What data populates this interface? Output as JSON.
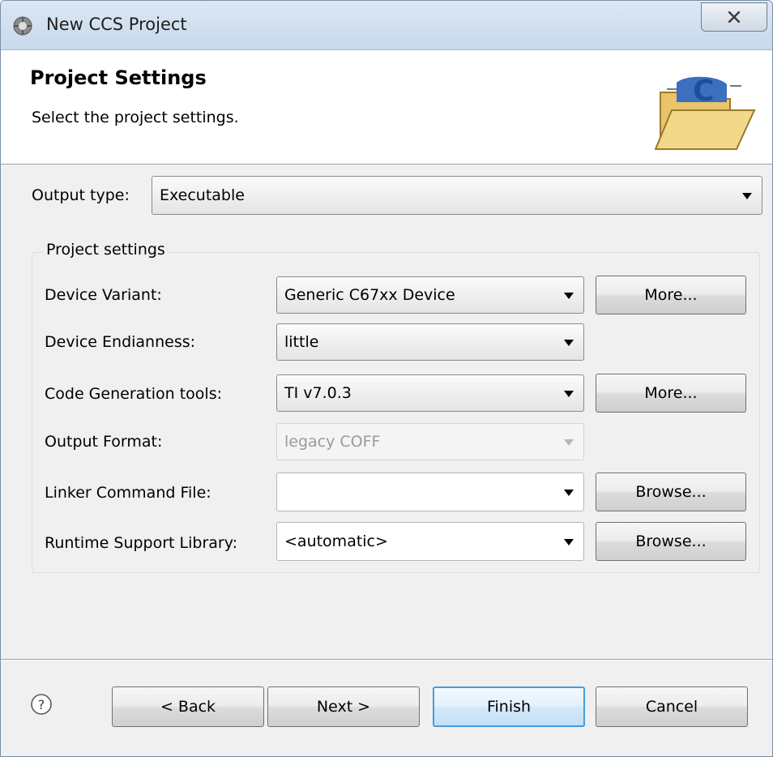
{
  "window": {
    "title": "New CCS Project"
  },
  "header": {
    "title": "Project Settings",
    "description": "Select the project settings."
  },
  "output_type": {
    "label": "Output type:",
    "value": "Executable"
  },
  "project_settings": {
    "legend": "Project settings",
    "device_variant": {
      "label": "Device Variant:",
      "value": "Generic C67xx Device",
      "button": "More..."
    },
    "device_endianness": {
      "label": "Device Endianness:",
      "value": "little"
    },
    "code_generation_tools": {
      "label": "Code Generation tools:",
      "value": "TI v7.0.3",
      "button": "More..."
    },
    "output_format": {
      "label": "Output Format:",
      "value": "legacy COFF"
    },
    "linker_command_file": {
      "label": "Linker Command File:",
      "value": "",
      "button": "Browse..."
    },
    "runtime_support_library": {
      "label": "Runtime Support Library:",
      "value": "<automatic>",
      "button": "Browse..."
    }
  },
  "footer": {
    "back": "< Back",
    "next": "Next >",
    "finish": "Finish",
    "cancel": "Cancel"
  },
  "colors": {
    "default_button_border": "#4a9bd8",
    "titlebar": "#c8d9ec"
  }
}
